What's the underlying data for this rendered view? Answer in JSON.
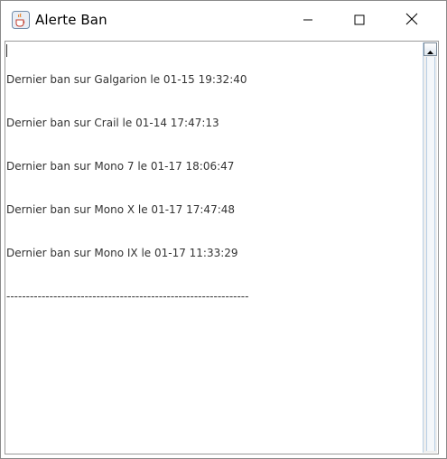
{
  "window": {
    "title": "Alerte Ban",
    "icon": "java-cup-icon",
    "controls": {
      "minimize_icon": "minimize-icon",
      "maximize_icon": "maximize-icon",
      "close_icon": "close-icon"
    }
  },
  "log": {
    "lines": [
      "Dernier ban sur Galgarion le 01-15 19:32:40",
      "Dernier ban sur Crail le 01-14 17:47:13",
      "Dernier ban sur Mono 7 le 01-17 18:06:47",
      "Dernier ban sur Mono X le 01-17 17:47:48",
      "Dernier ban sur Mono IX le 01-17 11:33:29"
    ],
    "separator": "--------------------------------------------------------------"
  },
  "colors": {
    "text": "#333333",
    "border": "#9a9a9a",
    "scroll_accent": "#b8cfe5"
  }
}
